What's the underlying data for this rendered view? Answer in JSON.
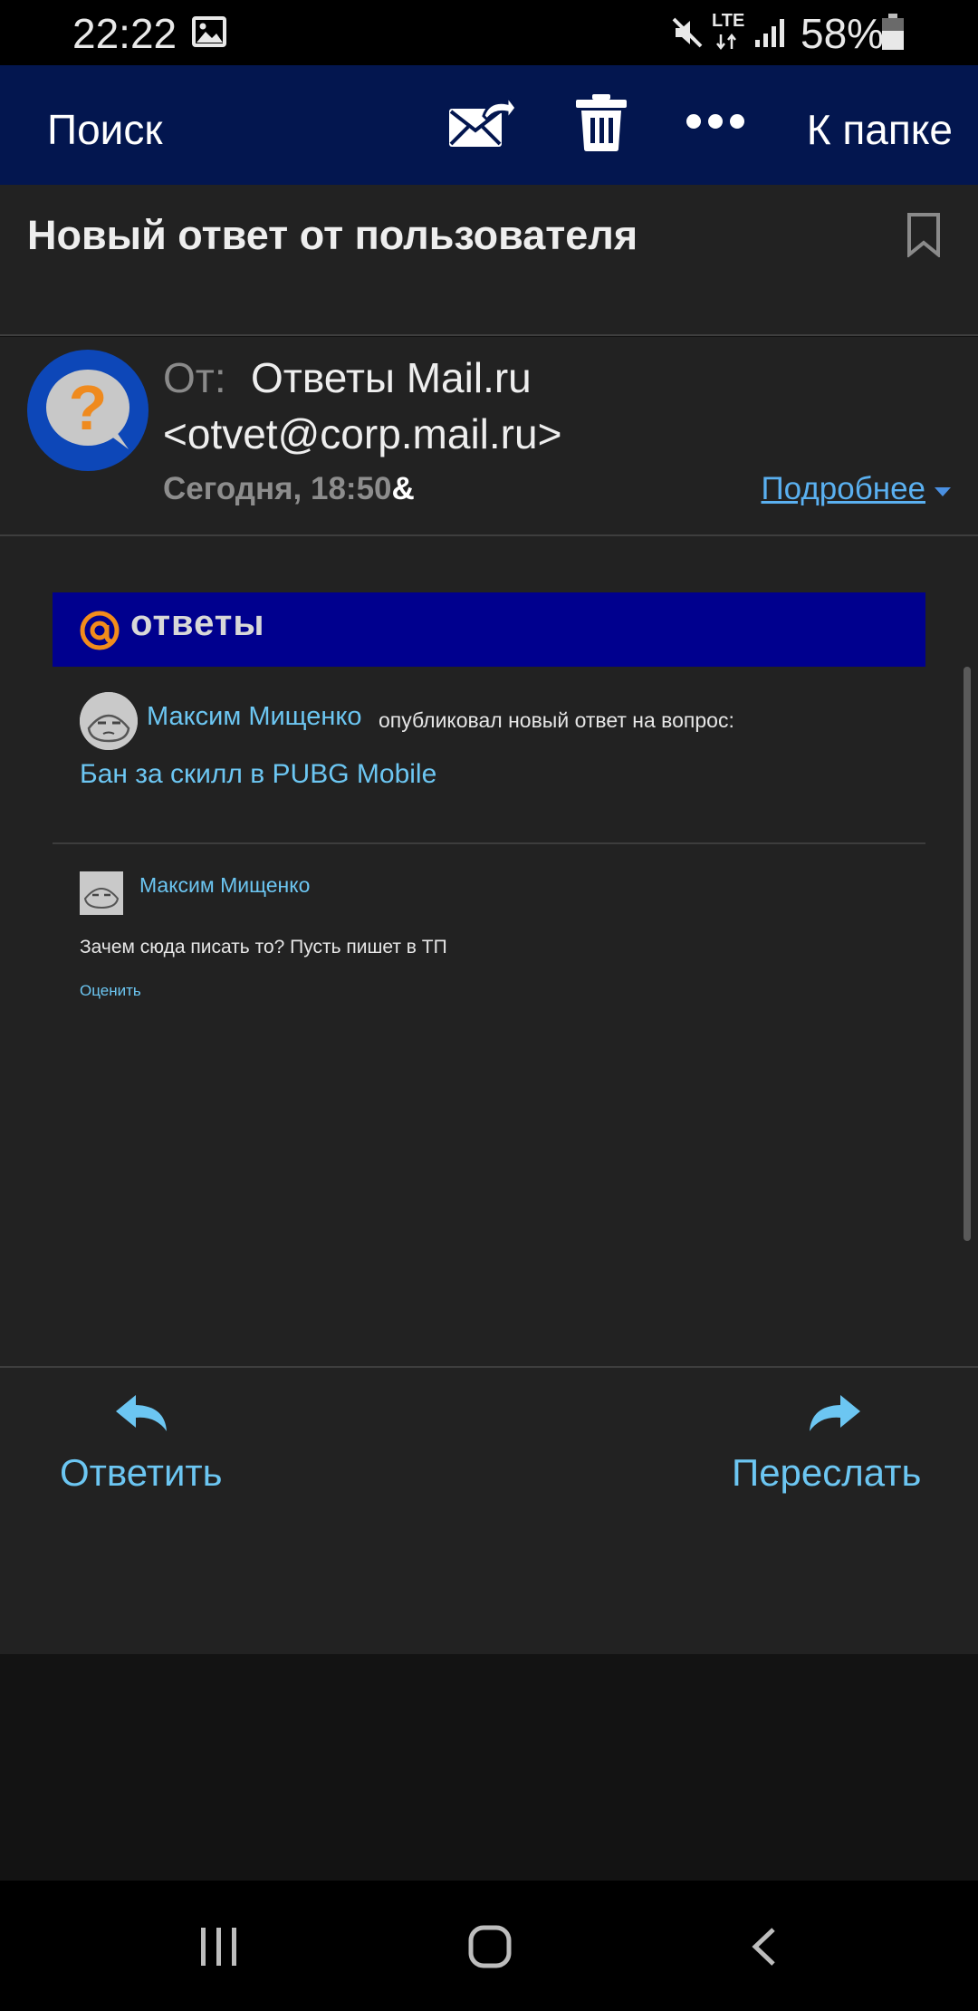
{
  "status_bar": {
    "time": "22:22",
    "battery_percent": "58%",
    "network": "LTE",
    "icons": [
      "gallery-icon",
      "mute-icon",
      "lte-icon",
      "signal-icon",
      "battery-icon"
    ]
  },
  "toolbar": {
    "search_label": "Поиск",
    "back_to_folder_label": "К папке",
    "icons": [
      "mark-unread-icon",
      "trash-icon",
      "more-icon"
    ]
  },
  "message": {
    "subject": "Новый ответ от пользователя",
    "from_label": "От:",
    "from_name": "Ответы Mail.ru",
    "from_email": "<otvet@corp.mail.ru>",
    "date": "Сегодня, 18:50",
    "date_suffix": "&",
    "details_label": "Подробнее"
  },
  "email_body": {
    "banner_logo_text": "ответы",
    "author_name": "Максим Мищенко",
    "published_text": "опубликовал новый ответ на вопрос:",
    "question_title": "Бан за скилл в PUBG Mobile",
    "answer_author": "Максим Мищенко",
    "answer_text": "Зачем сюда писать то? Пусть пишет в ТП",
    "rate_label": "Оценить"
  },
  "actions": {
    "reply_label": "Ответить",
    "forward_label": "Переслать"
  },
  "colors": {
    "toolbar_bg": "#03164f",
    "link": "#6cc6f2",
    "banner_bg": "#00008e",
    "panel_bg": "#222222"
  }
}
